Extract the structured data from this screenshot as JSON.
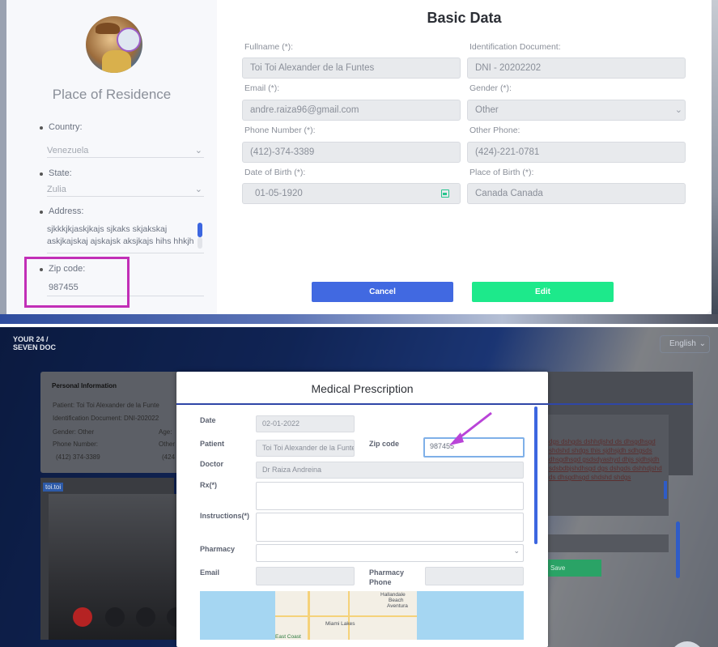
{
  "top": {
    "residence": {
      "title": "Place of Residence",
      "country_label": "Country:",
      "country_value": "Venezuela",
      "state_label": "State:",
      "state_value": "Zulia",
      "address_label": "Address:",
      "address_line1": "sjkkkjkjaskjkajs sjkaks skjakskaj",
      "address_line2": "askjkajskaj ajskajsk aksjkajs hihs hhkjh",
      "zip_label": "Zip code:",
      "zip_value": "987455"
    },
    "basic_data": {
      "title": "Basic Data",
      "fullname_label": "Fullname (*):",
      "fullname_value": "Toi Toi Alexander de la Funtes",
      "id_label": "Identification Document:",
      "id_value": "DNI - 20202202",
      "email_label": "Email (*):",
      "email_value": "andre.raiza96@gmail.com",
      "gender_label": "Gender (*):",
      "gender_value": "Other",
      "phone_label": "Phone Number (*):",
      "phone_value": "(412)-374-3389",
      "other_phone_label": "Other Phone:",
      "other_phone_value": "(424)-221-0781",
      "dob_label": "Date of Birth (*):",
      "dob_value": "01-05-1920",
      "pob_label": "Place of Birth (*):",
      "pob_value": "Canada Canada",
      "cancel_label": "Cancel",
      "edit_label": "Edit"
    },
    "colors": {
      "cancel": "#4169e1",
      "edit": "#1de98b",
      "highlight": "#c22fb7"
    }
  },
  "bottom": {
    "logo_line1": "YOUR 24 /",
    "logo_line2": "SEVEN DOC",
    "language": "English",
    "personal_info": {
      "title": "Personal Information",
      "patient": "Patient:   Toi Toi Alexander de la Funte",
      "id_doc": "Identification Document:    DNI-202022",
      "gender": "Gender:  Other",
      "age": "Age:",
      "phone_label": "Phone Number:",
      "other": "Other",
      "phone_value": "(412) 374-3389",
      "phone_value2": "(424"
    },
    "video_label": "toi.toi",
    "right_text": "dgs dshgds dshhdjshd ds dhsgdhsgd shdshd shdgs this sjdhsjdh sdhgsds dhsgdhsgd gsdsdyashyd dhjs sjdhsjdh sdsbdbjshdhsgd dgs dshgds dshhdjshd ds dhsgdhsgd shdshd shdgs",
    "save_label": "Save",
    "prescription": {
      "title": "Medical Prescription",
      "date_label": "Date",
      "date_value": "02-01-2022",
      "patient_label": "Patient",
      "patient_value": "Toi Toi Alexander de la Funtes",
      "zip_label": "Zip code",
      "zip_value": "987455",
      "doctor_label": "Doctor",
      "doctor_value": "Dr Raiza Andreina",
      "rx_label": "Rx(*)",
      "instructions_label": "Instructions(*)",
      "pharmacy_label": "Pharmacy",
      "email_label": "Email",
      "pharmacy_phone_label_1": "Pharmacy",
      "pharmacy_phone_label_2": "Phone",
      "map_labels": [
        "Hallandale",
        "Beach",
        "Aventura",
        "Miami Lakes",
        "East Coast"
      ]
    }
  }
}
